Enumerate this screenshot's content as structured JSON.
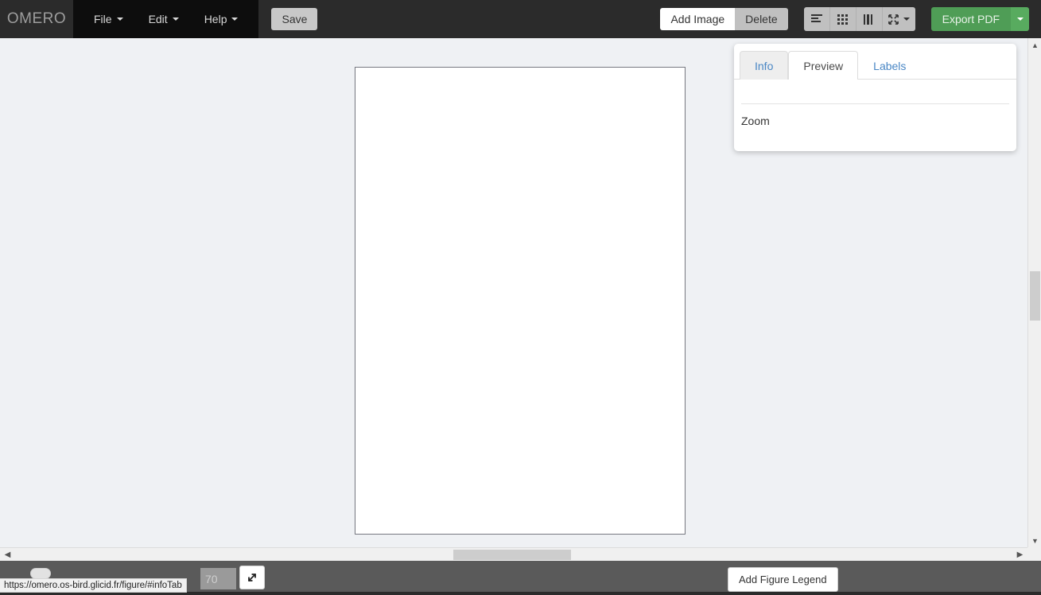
{
  "app": {
    "brand": "OMERO"
  },
  "navbar": {
    "menus": [
      {
        "label": "File",
        "icon": "chevron-down-icon"
      },
      {
        "label": "Edit",
        "icon": "chevron-down-icon"
      },
      {
        "label": "Help",
        "icon": "chevron-down-icon"
      }
    ],
    "save_label": "Save",
    "add_image_label": "Add Image",
    "delete_label": "Delete",
    "view_buttons": [
      {
        "name": "align-left-icon",
        "title": "List view"
      },
      {
        "name": "grid-icon",
        "title": "Grid view"
      },
      {
        "name": "columns-icon",
        "title": "Column view"
      },
      {
        "name": "expand-arrows-icon",
        "title": "Zoom to fit"
      }
    ],
    "export_label": "Export PDF",
    "export_caret_icon": "chevron-down-icon",
    "colors": {
      "navbar_bg": "#2b2b2b",
      "menu_bg": "#0d0d0d",
      "brand_text": "#9d9d9d",
      "export_green": "#4f9d56",
      "export_caret_green": "#58ab5f",
      "button_grey": "#c0c0c0"
    }
  },
  "side_panel": {
    "tabs": [
      {
        "label": "Info",
        "state": "hover"
      },
      {
        "label": "Preview",
        "state": "active"
      },
      {
        "label": "Labels",
        "state": "link"
      }
    ],
    "zoom_label": "Zoom"
  },
  "workspace": {
    "paper": {
      "background": "#ffffff",
      "border_color": "#767880"
    },
    "background": "#eff1f4"
  },
  "scrollbars": {
    "vertical": {
      "up_icon": "chevron-up-icon",
      "down_icon": "chevron-down-icon"
    },
    "horizontal": {
      "left_icon": "chevron-left-icon",
      "right_icon": "chevron-right-icon"
    }
  },
  "bottom_bar": {
    "zoom_value": "70",
    "expand_icon": "expand-diagonal-icon",
    "legend_label": "Add Figure Legend",
    "background": "#5a5a5a"
  },
  "status_bar": {
    "url": "https://omero.os-bird.glicid.fr/figure/#infoTab"
  }
}
